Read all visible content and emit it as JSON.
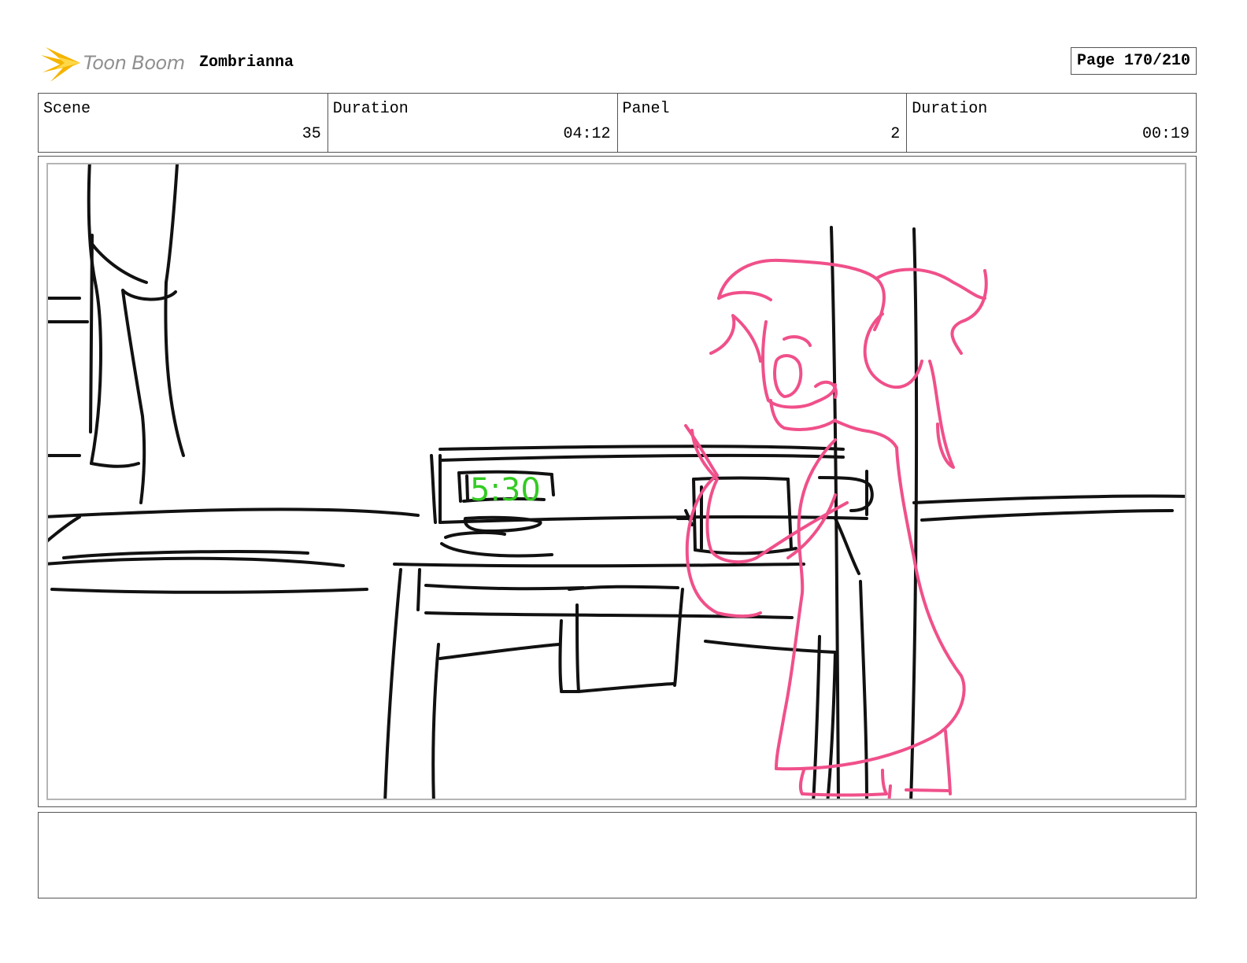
{
  "header": {
    "logo_text": "Toon Boom",
    "project_title": "Zombrianna",
    "page_label": "Page 170/210"
  },
  "info": [
    {
      "label": "Scene",
      "value": "35"
    },
    {
      "label": "Duration",
      "value": "04:12"
    },
    {
      "label": "Panel",
      "value": "2"
    },
    {
      "label": "Duration",
      "value": "00:19"
    }
  ],
  "panel": {
    "clock_text": "5:30",
    "colors": {
      "line": "#111111",
      "character": "#f0508a",
      "clock": "#33cc22"
    }
  },
  "notes": {
    "text": ""
  }
}
